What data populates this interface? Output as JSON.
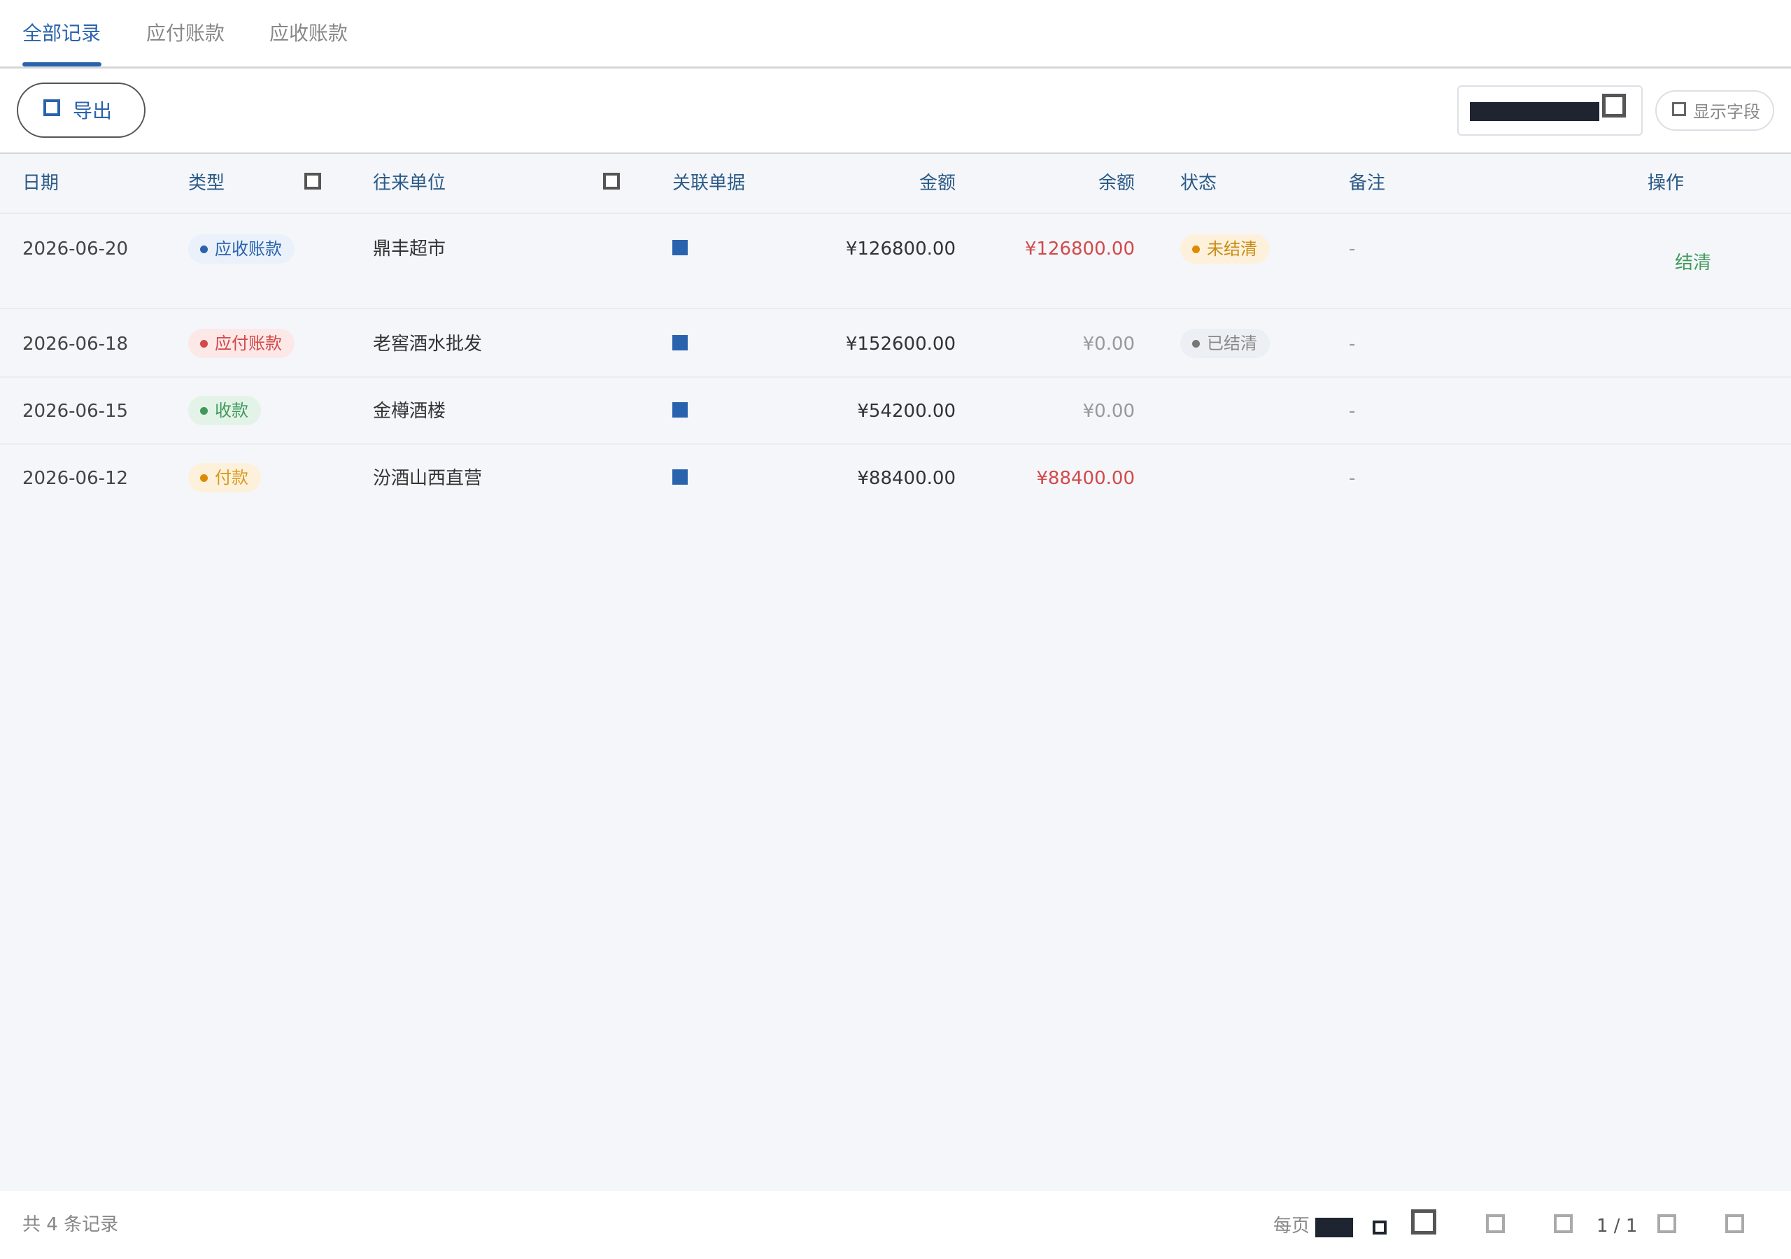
{
  "tabs": [
    {
      "label": "全部记录",
      "active": true
    },
    {
      "label": "应付账款",
      "active": false
    },
    {
      "label": "应收账款",
      "active": false
    }
  ],
  "toolbar": {
    "export_label": "导出",
    "fields_label": "显示字段"
  },
  "table": {
    "columns": {
      "date": "日期",
      "type": "类型",
      "party": "往来单位",
      "doc": "关联单据",
      "amount": "金额",
      "balance": "余额",
      "status": "状态",
      "note": "备注",
      "action": "操作"
    },
    "rows": [
      {
        "date": "2026-06-20",
        "type": "应收账款",
        "party": "鼎丰超市",
        "amount": "¥126800.00",
        "balance": "¥126800.00",
        "status": "未结清",
        "note": "-",
        "action": "结清"
      },
      {
        "date": "2026-06-18",
        "type": "应付账款",
        "party": "老窖酒水批发",
        "amount": "¥152600.00",
        "balance": "¥0.00",
        "status": "已结清",
        "note": "-",
        "action": ""
      },
      {
        "date": "2026-06-15",
        "type": "收款",
        "party": "金樽酒楼",
        "amount": "¥54200.00",
        "balance": "¥0.00",
        "status": "",
        "note": "-",
        "action": ""
      },
      {
        "date": "2026-06-12",
        "type": "付款",
        "party": "汾酒山西直营",
        "amount": "¥88400.00",
        "balance": "¥88400.00",
        "status": "",
        "note": "-",
        "action": ""
      }
    ]
  },
  "colors": {
    "accent": "#2a63ad",
    "receivable_bg": "#eaf1fb",
    "payable_bg": "#fde8e8",
    "payable_fg": "#d24a4a",
    "receipt_bg": "#e3f3e8",
    "receipt_fg": "#3f9a5a",
    "payment_bg": "#fdf1dc",
    "payment_fg": "#d99a1e",
    "unsettled_bg": "#fdf1dc",
    "settled_bg": "#eceff4",
    "settled_fg": "#888"
  },
  "footer": {
    "total": "共 4 条记录",
    "per_page_label": "每页",
    "page_info": "1 / 1"
  }
}
